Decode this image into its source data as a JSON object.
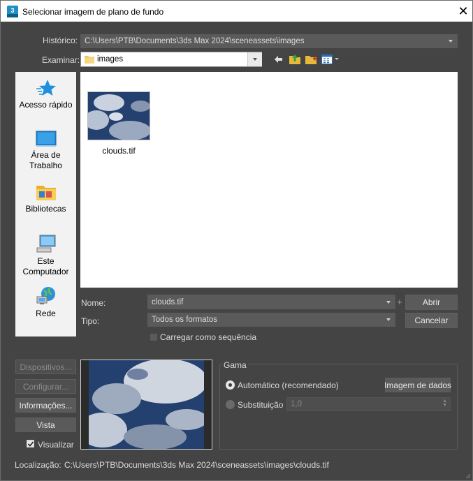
{
  "window": {
    "title": "Selecionar imagem de plano de fundo",
    "app_icon_text": "3",
    "close_glyph": "✕"
  },
  "history": {
    "label": "Histórico:",
    "value": "C:\\Users\\PTB\\Documents\\3ds Max 2024\\sceneassets\\images"
  },
  "browse": {
    "label": "Examinar:",
    "value": "images"
  },
  "sidebar": {
    "items": [
      {
        "label_lines": [
          "Acesso rápido"
        ],
        "icon": "star-icon"
      },
      {
        "label_lines": [
          "Área de",
          "Trabalho"
        ],
        "icon": "desktop-icon"
      },
      {
        "label_lines": [
          "Bibliotecas"
        ],
        "icon": "libraries-icon"
      },
      {
        "label_lines": [
          "Este",
          "Computador"
        ],
        "icon": "computer-icon"
      },
      {
        "label_lines": [
          "Rede"
        ],
        "icon": "network-icon"
      }
    ]
  },
  "files": [
    {
      "name": "clouds.tif"
    }
  ],
  "name_field": {
    "label": "Nome:",
    "value": "clouds.tif"
  },
  "type_field": {
    "label": "Tipo:",
    "value": "Todos os formatos"
  },
  "buttons": {
    "open": "Abrir",
    "cancel": "Cancelar",
    "plus": "+"
  },
  "sequence": {
    "label": "Carregar como sequência",
    "checked": false
  },
  "left_buttons": {
    "devices": "Dispositivos...",
    "configure": "Configurar...",
    "info": "Informações...",
    "view": "Vista"
  },
  "preview": {
    "label": "Visualizar",
    "checked": true
  },
  "gamma": {
    "title": "Gama",
    "automatic": "Automático (recomendado)",
    "data_image": "Imagem de dados",
    "override": "Substituição",
    "override_value": "1,0",
    "selected": "automatic"
  },
  "location": {
    "label": "Localização:",
    "value": "C:\\Users\\PTB\\Documents\\3ds Max 2024\\sceneassets\\images\\clouds.tif"
  },
  "colors": {
    "background": "#444444",
    "field": "#5a5a5a",
    "text": "#dcdcdc",
    "sidebar": "#f2f2f2",
    "accent": "#1e90d6"
  }
}
